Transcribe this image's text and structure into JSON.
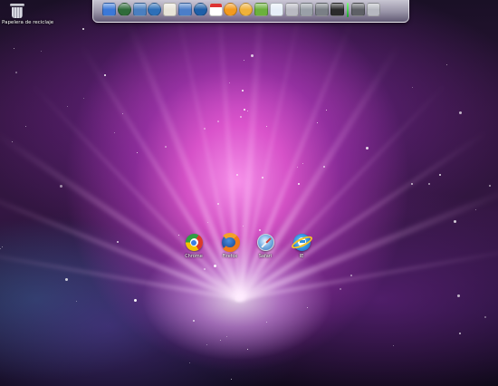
{
  "desktop": {
    "recycle_bin_label": "Papelera de reciclaje"
  },
  "dock": {
    "apps": [
      {
        "icon": "finder-icon",
        "color": "#3b78d8"
      },
      {
        "icon": "clock-icon",
        "color": "#2f6b3a"
      },
      {
        "icon": "network-icon",
        "color": "#4a7fc0"
      },
      {
        "icon": "globe-icon",
        "color": "#2d6fb8"
      },
      {
        "icon": "notes-icon",
        "color": "#e8e4d8"
      },
      {
        "icon": "database-icon",
        "color": "#4b7ec9"
      },
      {
        "icon": "media-player-icon",
        "color": "#1f5fa8"
      },
      {
        "icon": "calendar-icon",
        "color": "#ffffff"
      },
      {
        "icon": "media-icon",
        "color": "#f39a1e"
      },
      {
        "icon": "cd-icon",
        "color": "#f0b13a"
      },
      {
        "icon": "vista-icon",
        "color": "#6bb03c"
      },
      {
        "icon": "vs-icon",
        "color": "#e6eef8"
      },
      {
        "icon": "archive-icon",
        "color": "#b9b9c2"
      },
      {
        "icon": "settings-icon",
        "color": "#9aa0a8"
      },
      {
        "icon": "paint-icon",
        "color": "#7a7f86"
      },
      {
        "icon": "terminal-icon",
        "color": "#2b2b2b"
      },
      {
        "icon": "tools-icon",
        "color": "#5e6066"
      },
      {
        "icon": "trash-icon",
        "color": "#b6b8c0"
      }
    ]
  },
  "browsers": [
    {
      "label": "Chrome",
      "icon": "chrome-icon"
    },
    {
      "label": "Firefox",
      "icon": "firefox-icon"
    },
    {
      "label": "Safari",
      "icon": "safari-icon"
    },
    {
      "label": "IE",
      "icon": "internet-explorer-icon"
    }
  ]
}
